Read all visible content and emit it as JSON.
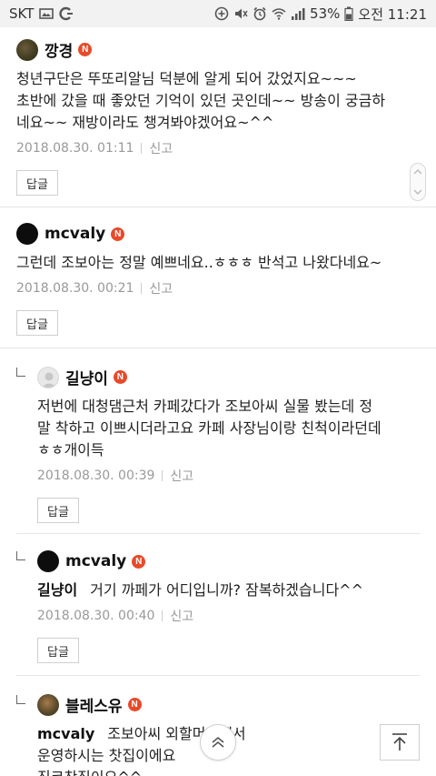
{
  "status_bar": {
    "carrier": "SKT",
    "battery": "53%",
    "time": "오전 11:21"
  },
  "labels": {
    "report": "신고",
    "reply": "답글"
  },
  "comments": [
    {
      "nickname": "깡경",
      "badge": "N",
      "text_lines": [
        "청년구단은 뚜또리알님 덕분에 알게 되어 갔었지요~~~",
        "초반에 갔을 때 좋았던 기억이 있던 곳인데~~ 방송이 궁금하",
        "네요~~ 재방이라도 챙겨봐야겠어요~^^"
      ],
      "date": "2018.08.30. 01:11"
    },
    {
      "nickname": "mcvaly",
      "badge": "N",
      "text_lines": [
        "그런데 조보아는 정말 예쁘네요..ㅎㅎㅎ 반석고 나왔다네요~"
      ],
      "date": "2018.08.30. 00:21"
    },
    {
      "nickname": "길냥이",
      "badge": "N",
      "text_lines": [
        "저번에 대청댐근처 카페갔다가 조보아씨 실물 봤는데 정",
        "말 착하고 이쁘시더라고요 카페 사장님이랑 친척이라던데",
        "ㅎㅎ개이득"
      ],
      "date": "2018.08.30. 00:39"
    },
    {
      "nickname": "mcvaly",
      "badge": "N",
      "mention": "길냥이",
      "text_lines": [
        "거기 까페가 어디입니까? 잠복하겠습니다^^"
      ],
      "date": "2018.08.30. 00:40"
    },
    {
      "nickname": "블레스유",
      "badge": "N",
      "mention": "mcvaly",
      "text_lines": [
        "조보아씨 외할머니께서",
        "운영하시는 찻집이에요",
        "직코찻집이요^^"
      ]
    }
  ]
}
